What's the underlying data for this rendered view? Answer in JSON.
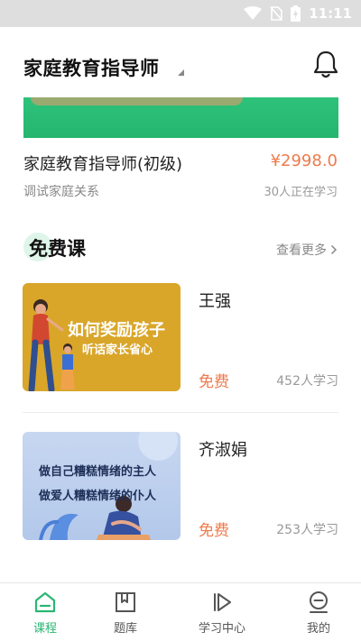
{
  "status_bar": {
    "time": "11:11"
  },
  "header": {
    "title": "家庭教育指导师"
  },
  "featured_course": {
    "title": "家庭教育指导师(初级)",
    "price": "¥2998.0",
    "subtitle": "调试家庭关系",
    "learners": "30人正在学习"
  },
  "free_section": {
    "title": "免费课",
    "see_more": "查看更多"
  },
  "free_courses": [
    {
      "name": "王强",
      "thumb_line1": "如何奖励孩子",
      "thumb_line2": "听话家长省心",
      "price": "免费",
      "learners": "452人学习"
    },
    {
      "name": "齐淑娟",
      "thumb_line1": "做自己糟糕情绪的主人",
      "thumb_line2": "做爱人糟糕情绪的仆人",
      "price": "免费",
      "learners": "253人学习"
    }
  ],
  "tabs": [
    {
      "label": "课程",
      "icon": "home-icon",
      "active": true
    },
    {
      "label": "题库",
      "icon": "bookmark-icon",
      "active": false
    },
    {
      "label": "学习中心",
      "icon": "play-icon",
      "active": false
    },
    {
      "label": "我的",
      "icon": "user-icon",
      "active": false
    }
  ],
  "colors": {
    "accent": "#2bb673",
    "price": "#ef7a4c",
    "banner": "#2ec27a"
  }
}
